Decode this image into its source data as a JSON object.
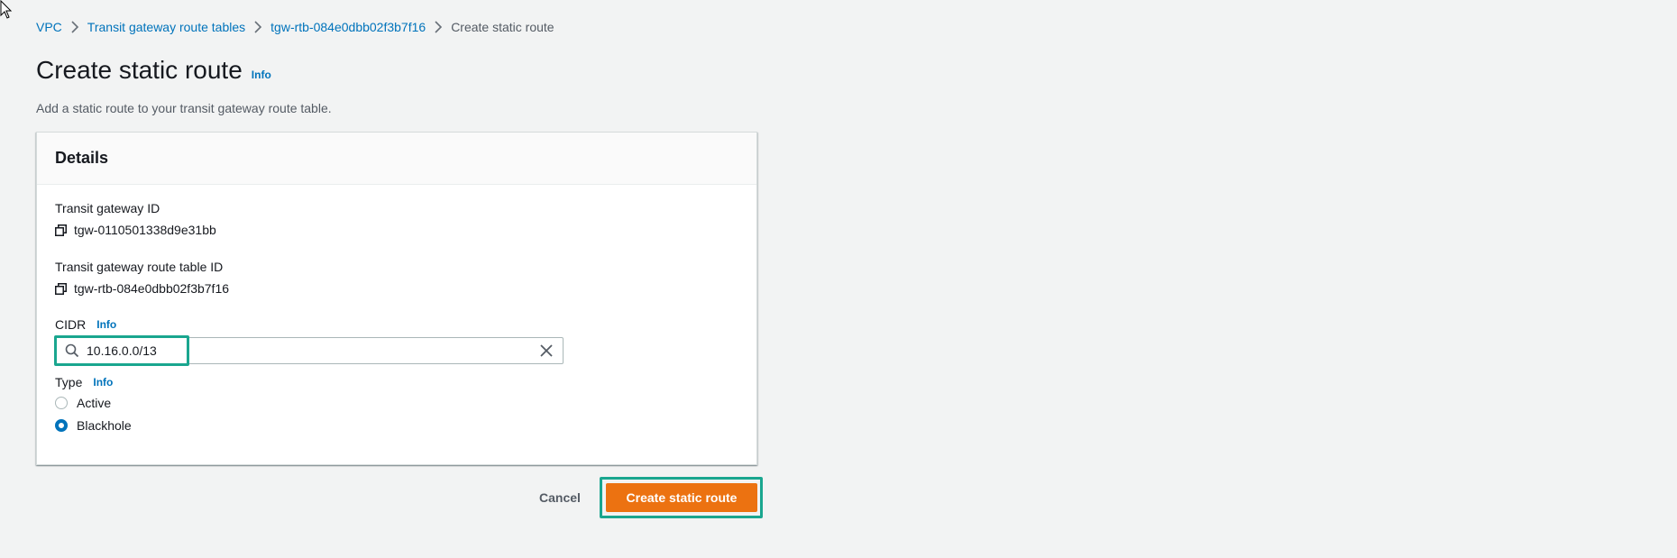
{
  "breadcrumb": {
    "items": [
      {
        "label": "VPC"
      },
      {
        "label": "Transit gateway route tables"
      },
      {
        "label": "tgw-rtb-084e0dbb02f3b7f16"
      }
    ],
    "current": "Create static route"
  },
  "page": {
    "title": "Create static route",
    "info_label": "Info",
    "description": "Add a static route to your transit gateway route table."
  },
  "details": {
    "title": "Details",
    "tgw_id_label": "Transit gateway ID",
    "tgw_id_value": "tgw-0110501338d9e31bb",
    "rtb_id_label": "Transit gateway route table ID",
    "rtb_id_value": "tgw-rtb-084e0dbb02f3b7f16",
    "cidr": {
      "label": "CIDR",
      "info_label": "Info",
      "value": "10.16.0.0/13"
    },
    "type": {
      "label": "Type",
      "info_label": "Info",
      "options": [
        {
          "label": "Active",
          "checked": false
        },
        {
          "label": "Blackhole",
          "checked": true
        }
      ]
    }
  },
  "actions": {
    "cancel_label": "Cancel",
    "create_label": "Create static route"
  },
  "colors": {
    "link": "#0073bb",
    "primary_button": "#ec7211",
    "highlight": "#1aa68f",
    "background": "#f2f3f3"
  },
  "icons": {
    "breadcrumb_separator": "chevron-right-icon",
    "copy": "copy-icon",
    "search": "search-icon",
    "clear": "clear-icon",
    "cursor": "mouse-cursor-icon"
  }
}
